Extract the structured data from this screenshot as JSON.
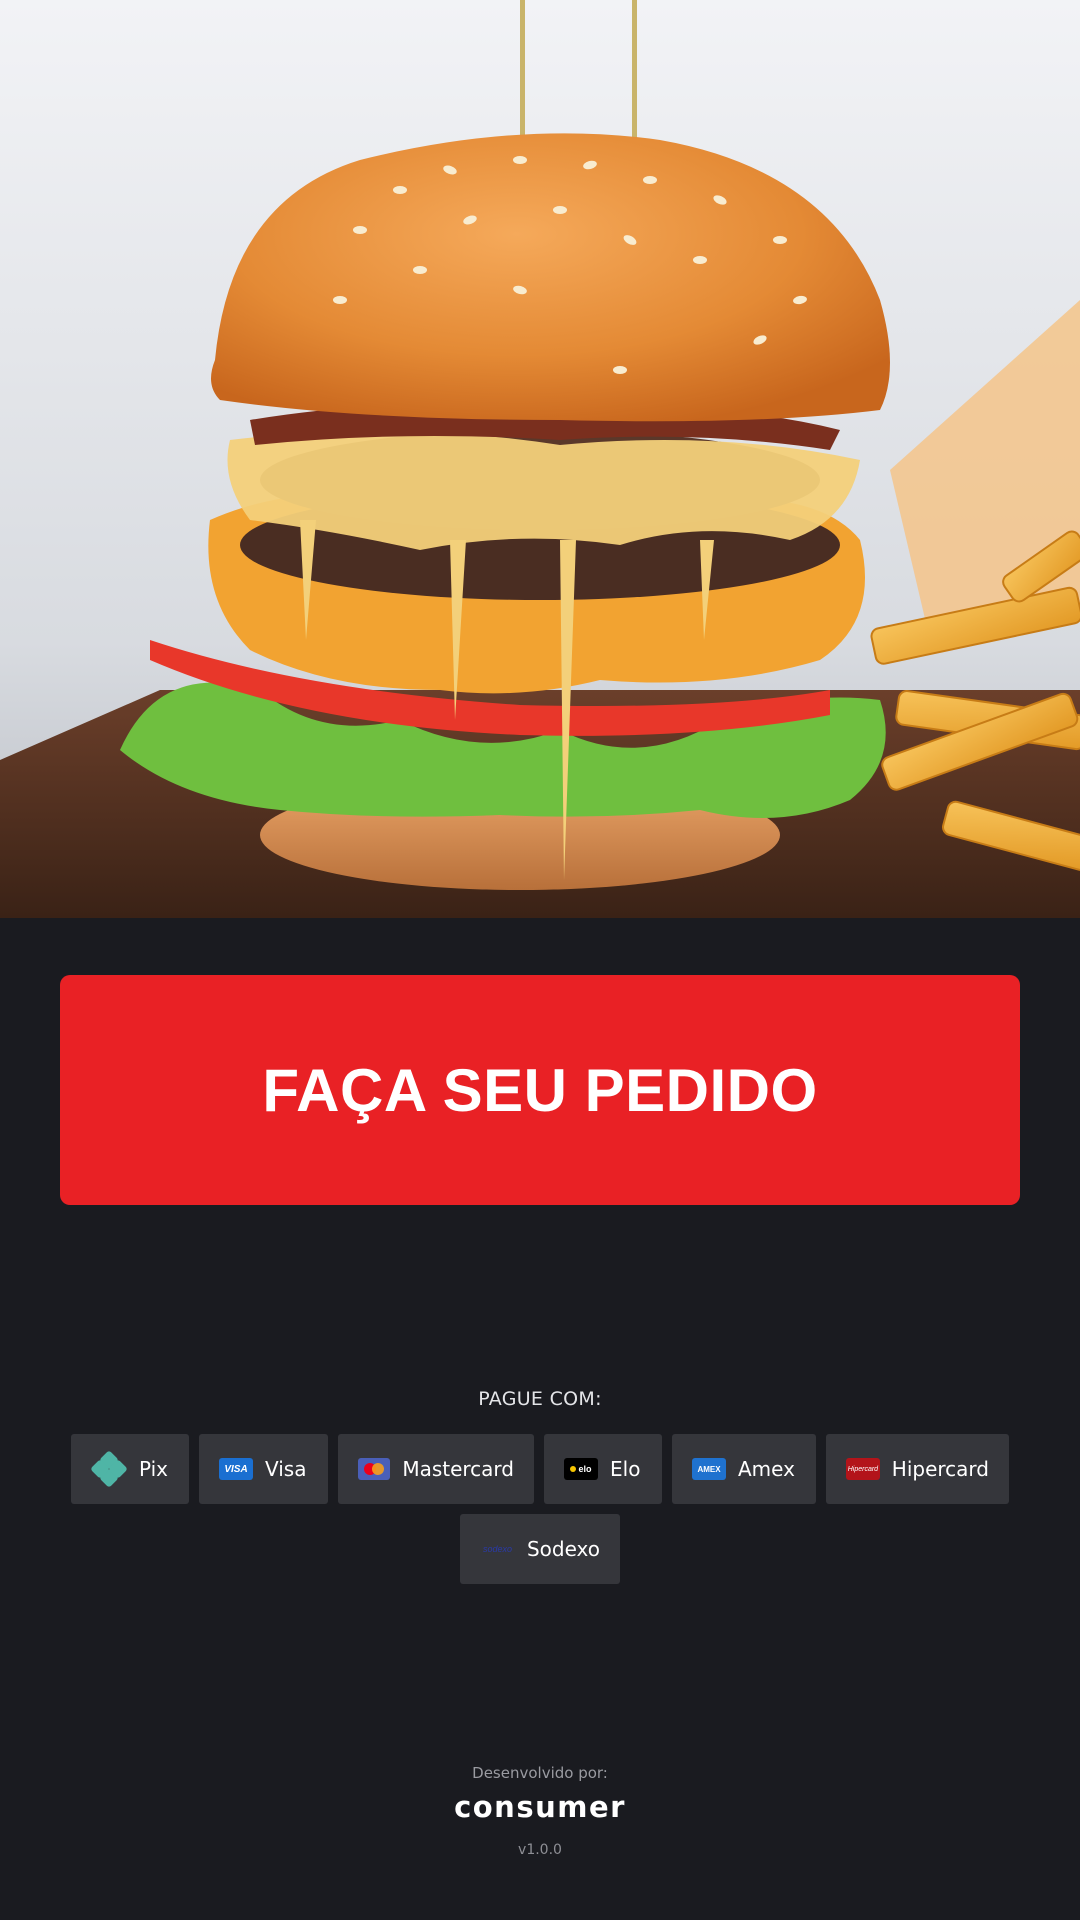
{
  "hero": {
    "image_description_icon": "burger-photo"
  },
  "order_button": {
    "label": "FAÇA SEU PEDIDO",
    "color": "#e92125"
  },
  "payment": {
    "title": "PAGUE COM:",
    "methods": [
      {
        "label": "Pix",
        "icon": "pix-icon"
      },
      {
        "label": "Visa",
        "icon": "visa-icon",
        "logo_text": "VISA"
      },
      {
        "label": "Mastercard",
        "icon": "mastercard-icon"
      },
      {
        "label": "Elo",
        "icon": "elo-icon",
        "logo_text": "elo"
      },
      {
        "label": "Amex",
        "icon": "amex-icon",
        "logo_text": "AMEX"
      },
      {
        "label": "Hipercard",
        "icon": "hipercard-icon",
        "logo_text": "Hipercard"
      },
      {
        "label": "Sodexo",
        "icon": "sodexo-icon",
        "logo_text": "sodexo"
      }
    ]
  },
  "footer": {
    "developed_by": "Desenvolvido por:",
    "brand": "consumer",
    "version": "v1.0.0"
  },
  "colors": {
    "background": "#1a1b20",
    "chip": "#35363b",
    "accent": "#e92125"
  }
}
